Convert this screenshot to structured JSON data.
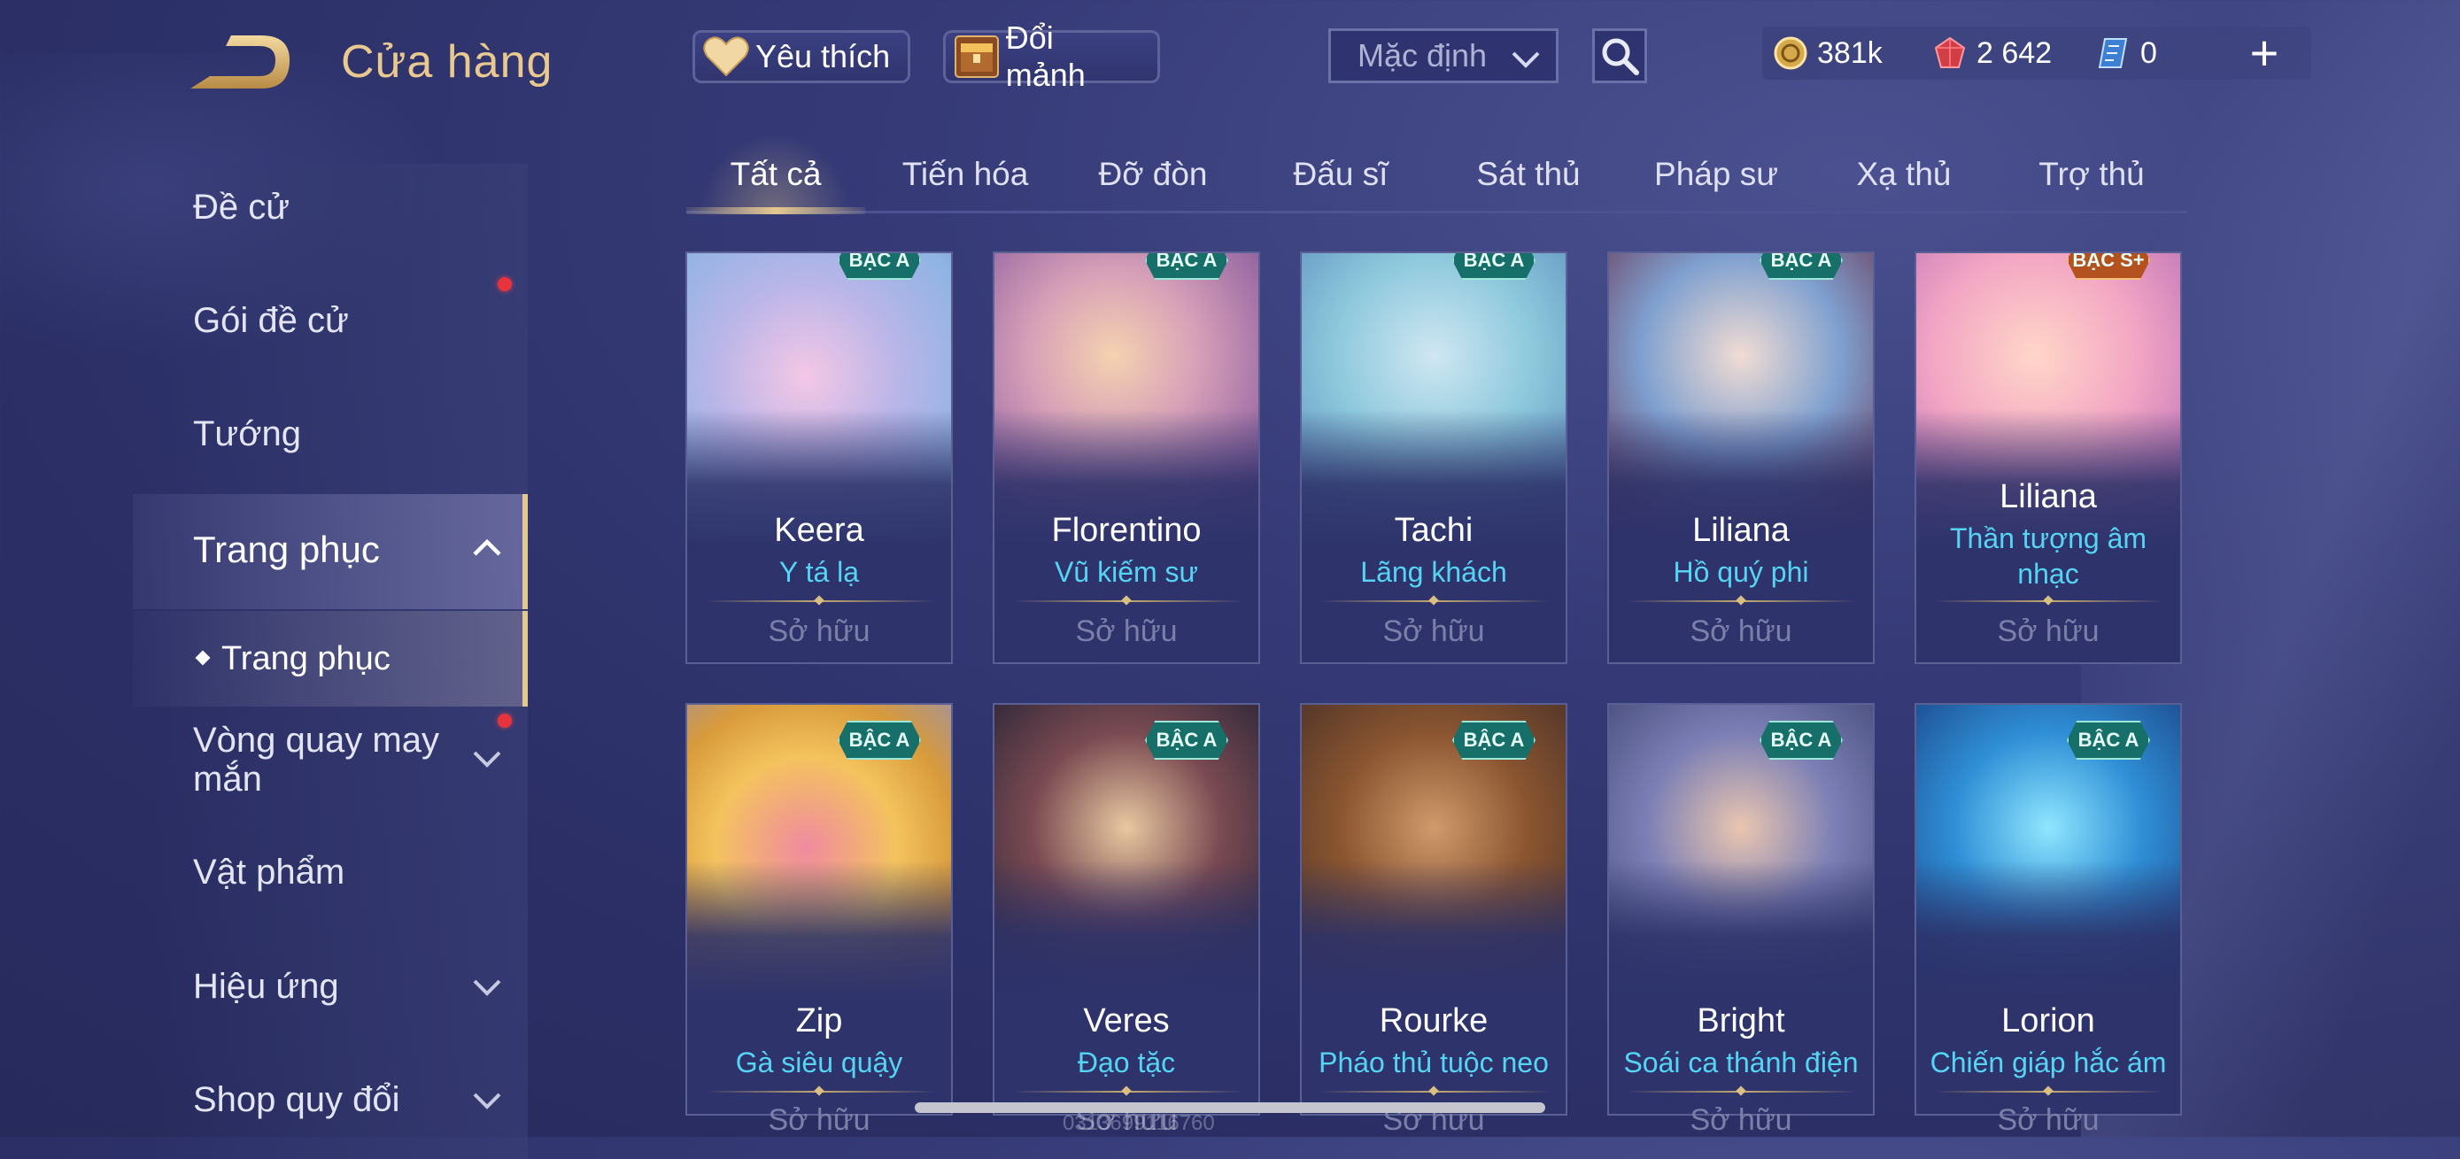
{
  "header": {
    "title": "Cửa hàng",
    "favorite_label": "Yêu thích",
    "shard_exchange_label": "Đổi mảnh",
    "sort_value": "Mặc định",
    "currencies": [
      {
        "name": "gold-coin",
        "value": "381k"
      },
      {
        "name": "ruby",
        "value": "2 642"
      },
      {
        "name": "ticket",
        "value": "0"
      }
    ],
    "plus_label": "+"
  },
  "sidebar": {
    "items": [
      {
        "label": "Đề cử"
      },
      {
        "label": "Gói đề cử",
        "badge": true
      },
      {
        "label": "Tướng"
      },
      {
        "label": "Trang phục",
        "expanded": true,
        "active": true
      },
      {
        "label": "Vòng quay may mắn",
        "badge": true,
        "has_submenu": true
      },
      {
        "label": "Vật phẩm"
      },
      {
        "label": "Hiệu ứng",
        "has_submenu": true
      },
      {
        "label": "Shop quy đổi",
        "has_submenu": true
      }
    ],
    "subitem": {
      "label": "Trang phục",
      "active": true
    }
  },
  "tabs": [
    "Tất cả",
    "Tiến hóa",
    "Đỡ đòn",
    "Đấu sĩ",
    "Sát thủ",
    "Pháp sư",
    "Xạ thủ",
    "Trợ thủ"
  ],
  "active_tab": "Tất cả",
  "cards": [
    {
      "hero": "Keera",
      "skin": "Y tá lạ",
      "rank": "BẬC A",
      "status": "Sở hữu"
    },
    {
      "hero": "Florentino",
      "skin": "Vũ kiếm sư",
      "rank": "BẬC A",
      "status": "Sở hữu"
    },
    {
      "hero": "Tachi",
      "skin": "Lãng khách",
      "rank": "BẬC A",
      "status": "Sở hữu"
    },
    {
      "hero": "Liliana",
      "skin": "Hồ quý phi",
      "rank": "BẬC A",
      "status": "Sở hữu"
    },
    {
      "hero": "Liliana",
      "skin": "Thần tượng âm nhạc",
      "rank": "BẬC S+",
      "status": "Sở hữu"
    },
    {
      "hero": "Zip",
      "skin": "Gà siêu quậy",
      "rank": "BẬC A",
      "status": "Sở hữu"
    },
    {
      "hero": "Veres",
      "skin": "Đạo tặc",
      "rank": "BẬC A",
      "status": "Sở hữu"
    },
    {
      "hero": "Rourke",
      "skin": "Pháo thủ tuộc neo",
      "rank": "BẬC A",
      "status": "Sở hữu"
    },
    {
      "hero": "Bright",
      "skin": "Soái ca thánh điện",
      "rank": "BẬC A",
      "status": "Sở hữu"
    },
    {
      "hero": "Lorion",
      "skin": "Chiến giáp hắc ám",
      "rank": "BẬC A",
      "status": "Sở hữu"
    }
  ],
  "watermark": "0313699116760",
  "colors": {
    "accent_gold": "#e3c88f",
    "skin_name_blue": "#55d4f4",
    "badge_red": "#e8323c",
    "rank_teal": "#176f6a"
  }
}
